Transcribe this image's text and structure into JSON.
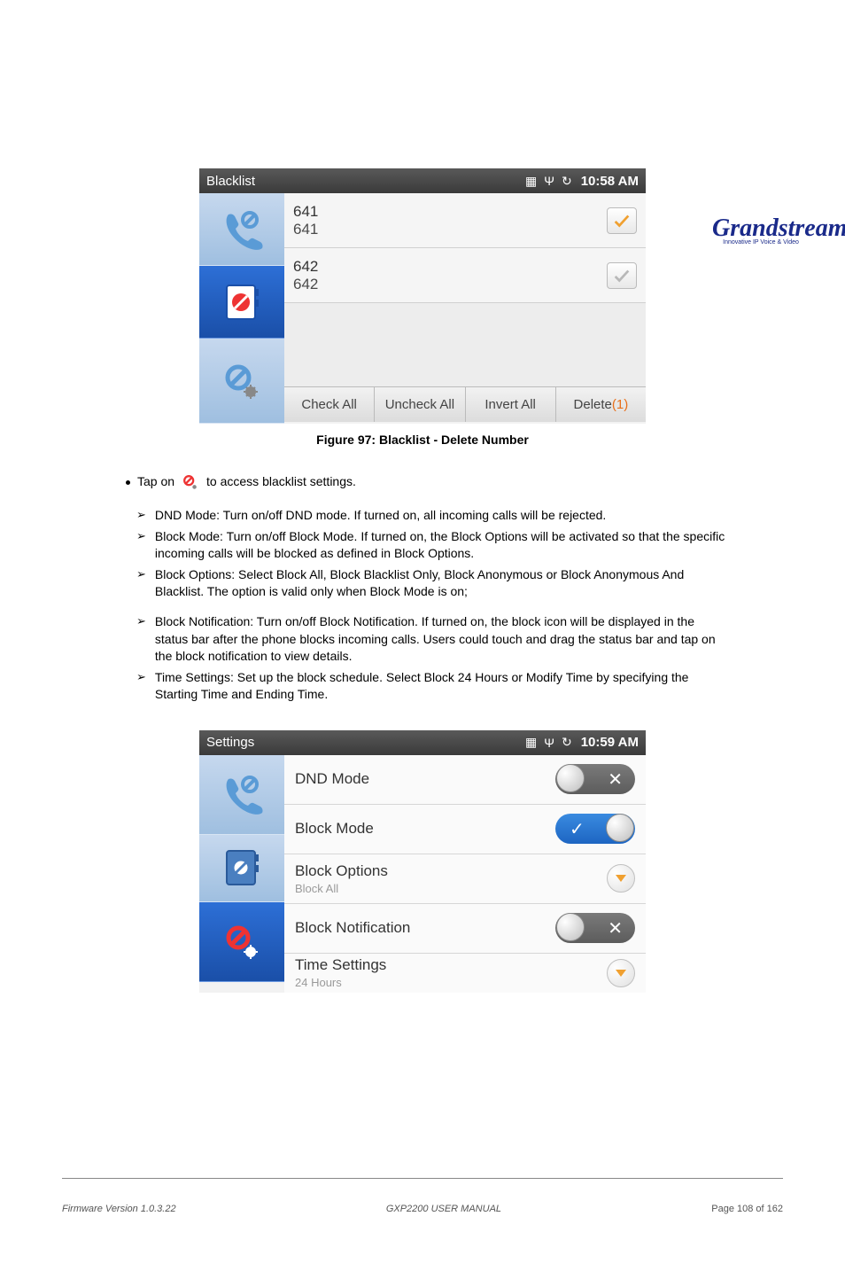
{
  "logo": {
    "brand": "Grandstream",
    "tagline": "Innovative IP Voice & Video"
  },
  "screen1": {
    "title": "Blacklist",
    "time": "10:58 AM",
    "rows": [
      {
        "name": "641",
        "number": "641",
        "checked": true
      },
      {
        "name": "642",
        "number": "642",
        "checked": false
      }
    ],
    "buttons": {
      "check_all": "Check All",
      "uncheck_all": "Uncheck All",
      "invert_all": "Invert All",
      "delete_label": "Delete",
      "delete_count": "(1)"
    }
  },
  "caption1": "Figure 97: Blacklist - Delete Number",
  "settings_intro_left": "Tap on",
  "settings_intro_right": "to access blacklist settings.",
  "settings_list": {
    "i1": "DND Mode: Turn on/off DND mode. If turned on, all incoming calls will be rejected.",
    "i2": "Block Mode: Turn on/off Block Mode. If turned on, the Block Options will be activated so that the specific incoming calls will be blocked as defined in Block Options.",
    "i3": "Block Options: Select Block All, Block Blacklist Only, Block Anonymous or Block Anonymous And Blacklist. The option is valid only when Block Mode is on;",
    "i4": "Block Notification: Turn on/off Block Notification. If turned on, the block icon will be displayed in the status bar after the phone blocks incoming calls. Users could touch and drag the status bar and tap on the block notification to view details.",
    "i5": "Time Settings: Set up the block schedule. Select Block 24 Hours or Modify Time by specifying the Starting Time and Ending Time."
  },
  "screen2": {
    "title": "Settings",
    "time": "10:59 AM",
    "rows": {
      "dnd": "DND Mode",
      "block_mode": "Block Mode",
      "block_options": "Block Options",
      "block_options_sub": "Block All",
      "block_notif": "Block Notification",
      "time_settings": "Time Settings",
      "time_settings_sub": "24 Hours"
    }
  },
  "footer": {
    "left": "Firmware Version 1.0.3.22",
    "center": "GXP2200 USER MANUAL",
    "right": "Page 108 of 162"
  }
}
